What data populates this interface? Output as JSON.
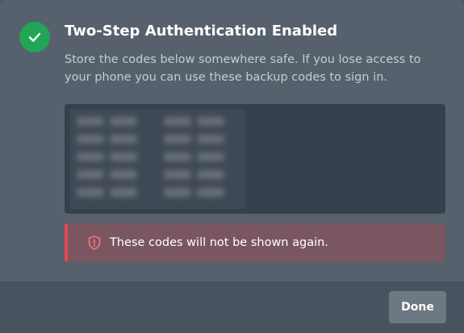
{
  "dialog": {
    "title": "Two-Step Authentication Enabled",
    "description": "Store the codes below somewhere safe. If you lose access to your phone you can use these backup codes to sign in.",
    "icon": "check-icon",
    "success_color": "#22a656"
  },
  "backup_codes": {
    "blurred": true,
    "column_1": [
      "XXXX XXXX",
      "XXXX XXXX",
      "XXXX XXXX",
      "XXXX XXXX",
      "XXXX XXXX"
    ],
    "column_2": [
      "XXXX XXXX",
      "XXXX XXXX",
      "XXXX XXXX",
      "XXXX XXXX",
      "XXXX XXXX"
    ]
  },
  "warning": {
    "icon": "shield-alert-icon",
    "text": "These codes will not be shown again.",
    "accent_color": "#e5484d"
  },
  "footer": {
    "done_label": "Done"
  }
}
